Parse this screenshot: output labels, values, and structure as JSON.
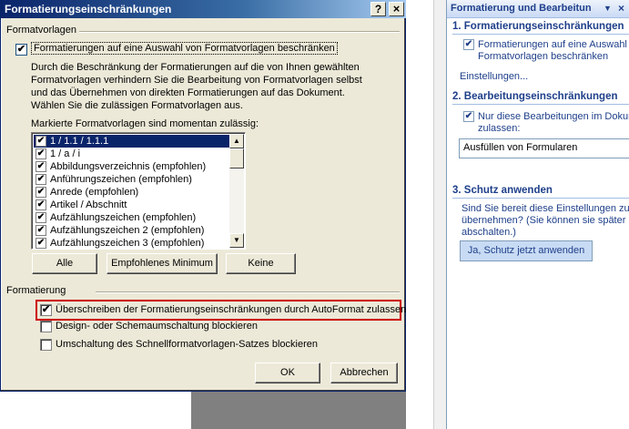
{
  "dialog": {
    "title": "Formatierungseinschränkungen",
    "help_glyph": "?",
    "close_glyph": "×",
    "group_formatvorlagen": "Formatvorlagen",
    "limit_checkbox": {
      "label": "Formatierungen auf eine Auswahl von Formatvorlagen beschränken",
      "checked": true
    },
    "description": "Durch die Beschränkung der Formatierungen auf die von Ihnen gewählten Formatvorlagen verhindern Sie die Bearbeitung von Formatvorlagen selbst und das Übernehmen von direkten Formatierungen auf das Dokument. Wählen Sie die zulässigen Formatvorlagen aus.",
    "list_caption": "Markierte Formatvorlagen sind momentan zulässig:",
    "styles": [
      {
        "label": "1 / 1.1 / 1.1.1",
        "checked": true,
        "selected": true
      },
      {
        "label": "1 / a / i",
        "checked": true,
        "selected": false
      },
      {
        "label": "Abbildungsverzeichnis (empfohlen)",
        "checked": true,
        "selected": false
      },
      {
        "label": "Anführungszeichen (empfohlen)",
        "checked": true,
        "selected": false
      },
      {
        "label": "Anrede (empfohlen)",
        "checked": true,
        "selected": false
      },
      {
        "label": "Artikel / Abschnitt",
        "checked": true,
        "selected": false
      },
      {
        "label": "Aufzählungszeichen (empfohlen)",
        "checked": true,
        "selected": false
      },
      {
        "label": "Aufzählungszeichen 2 (empfohlen)",
        "checked": true,
        "selected": false
      },
      {
        "label": "Aufzählungszeichen 3 (empfohlen)",
        "checked": true,
        "selected": false
      }
    ],
    "btn_alle": "Alle",
    "btn_empfohlen": "Empfohlenes Minimum",
    "btn_keine": "Keine",
    "group_formatierung": "Formatierung",
    "opt_autoformat": {
      "label": "Überschreiben der Formatierungseinschränkungen durch AutoFormat zulassen",
      "checked": true
    },
    "opt_design": {
      "label": "Design- oder Schemaumschaltung blockieren",
      "checked": false
    },
    "opt_schnell": {
      "label": "Umschaltung des Schnellformatvorlagen-Satzes blockieren",
      "checked": false
    },
    "btn_ok": "OK",
    "btn_cancel": "Abbrechen"
  },
  "pane": {
    "title": "Formatierung und Bearbeitun",
    "dropdown_glyph": "▼",
    "close_glyph": "×",
    "sec1_title": "1. Formatierungseinschränkungen",
    "sec1_checkbox": {
      "label_line1": "Formatierungen auf eine Auswahl v",
      "label_line2": "Formatvorlagen beschränken",
      "checked": true
    },
    "settings_link": "Einstellungen...",
    "sec2_title": "2. Bearbeitungseinschränkungen",
    "sec2_checkbox": {
      "label_line1": "Nur diese Bearbeitungen im Dokume",
      "label_line2": "zulassen:",
      "checked": true
    },
    "edit_type_value": "Ausfüllen von Formularen",
    "sec3_title": "3. Schutz anwenden",
    "sec3_text_line1": "Sind Sie bereit diese Einstellungen zu",
    "sec3_text_line2": "übernehmen? (Sie können sie später",
    "sec3_text_line3": "abschalten.)",
    "protect_button": "Ja, Schutz jetzt anwenden"
  },
  "check_glyph": "✔"
}
